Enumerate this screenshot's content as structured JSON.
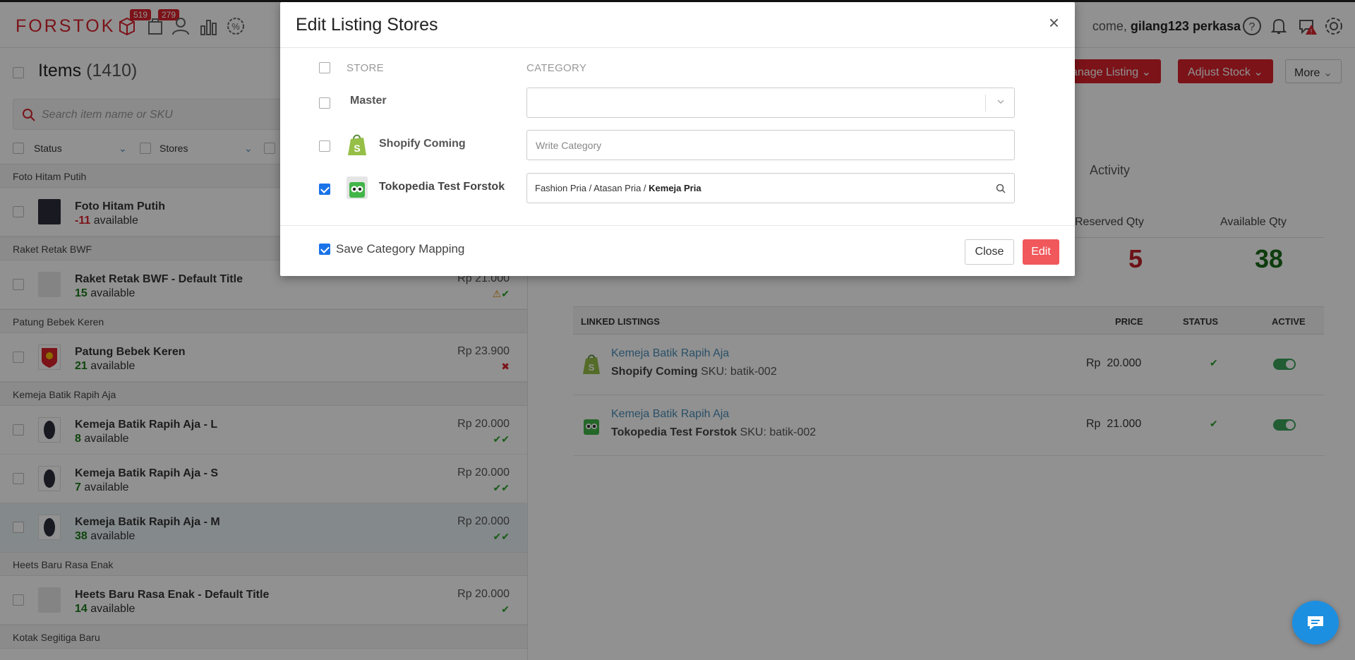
{
  "header": {
    "logo": "FORSTOK",
    "badge_orders": "519",
    "badge_returns": "279",
    "welcome_prefix": "come,",
    "username": "gilang123 perkasa"
  },
  "left": {
    "items_title": "Items",
    "items_count": "(1410)",
    "search_placeholder": "Search item name or SKU",
    "filter_status": "Status",
    "filter_stores": "Stores",
    "groups": [
      "Foto Hitam Putih",
      "Raket Retak BWF",
      "Patung Bebek Keren",
      "Kemeja Batik Rapih Aja",
      "Heets Baru Rasa Enak",
      "Kotak Segitiga Baru"
    ],
    "items": [
      {
        "title": "Foto Hitam Putih",
        "qty": "-11",
        "avail": "available",
        "price": "",
        "status": ""
      },
      {
        "title": "Raket Retak BWF - Default Title",
        "qty": "15",
        "avail": "available",
        "price": "Rp 21.000",
        "status": "⚠✔"
      },
      {
        "title": "Patung Bebek Keren",
        "qty": "21",
        "avail": "available",
        "price": "Rp 23.900",
        "status": "✖"
      },
      {
        "title": "Kemeja Batik Rapih Aja - L",
        "qty": "8",
        "avail": "available",
        "price": "Rp 20.000",
        "status": "✔✔"
      },
      {
        "title": "Kemeja Batik Rapih Aja - S",
        "qty": "7",
        "avail": "available",
        "price": "Rp 20.000",
        "status": "✔✔"
      },
      {
        "title": "Kemeja Batik Rapih Aja - M",
        "qty": "38",
        "avail": "available",
        "price": "Rp 20.000",
        "status": "✔✔"
      },
      {
        "title": "Heets Baru Rasa Enak - Default Title",
        "qty": "14",
        "avail": "available",
        "price": "Rp 20.000",
        "status": "✔"
      }
    ]
  },
  "right": {
    "manage_listing": "anage Listing",
    "adjust_stock": "Adjust Stock",
    "more": "More",
    "activity_tab": "Activity",
    "reserved_label": "Reserved Qty",
    "reserved_value": "5",
    "available_label": "Available Qty",
    "available_value": "38",
    "linked_header": {
      "listings": "LINKED LISTINGS",
      "price": "PRICE",
      "status": "STATUS",
      "active": "ACTIVE"
    },
    "linked_rows": [
      {
        "title": "Kemeja Batik Rapih Aja",
        "store": "Shopify Coming",
        "sku": "SKU: batik-002",
        "currency": "Rp",
        "price": "20.000",
        "status": "✔"
      },
      {
        "title": "Kemeja Batik Rapih Aja",
        "store": "Tokopedia Test Forstok",
        "sku": "SKU: batik-002",
        "currency": "Rp",
        "price": "21.000",
        "status": "✔"
      }
    ]
  },
  "modal": {
    "title": "Edit Listing Stores",
    "close_x": "×",
    "col_store": "STORE",
    "col_category": "CATEGORY",
    "rows": [
      {
        "store": "Master",
        "category": "",
        "checked": false
      },
      {
        "store": "Shopify Coming",
        "category_placeholder": "Write Category",
        "checked": false
      },
      {
        "store": "Tokopedia Test Forstok",
        "category_path": "Fashion Pria / Atasan Pria / ",
        "category_leaf": "Kemeja Pria",
        "checked": true
      }
    ],
    "save_mapping": "Save Category Mapping",
    "close_button": "Close",
    "edit_button": "Edit"
  },
  "colors": {
    "brand_red": "#d9232d",
    "edit_button": "#f0585c",
    "checkbox_blue": "#1a73e8",
    "available_green": "#1a7a1a",
    "link_blue": "#4a8db7",
    "chat_blue": "#1d8fe1"
  }
}
